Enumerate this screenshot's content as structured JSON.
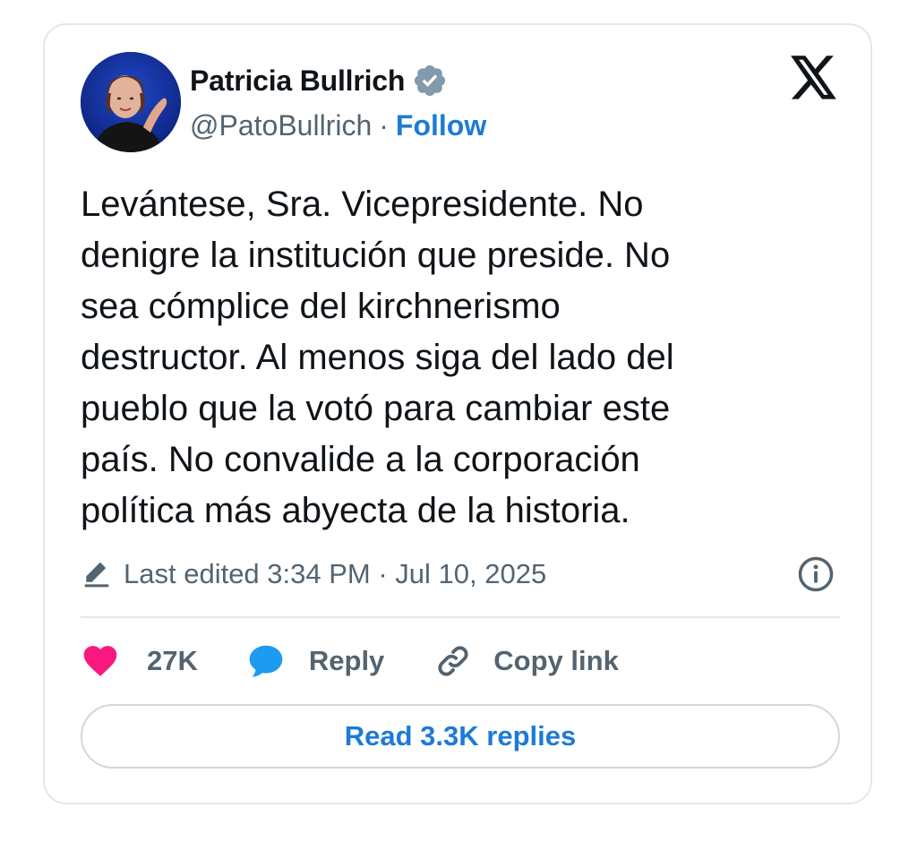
{
  "author": {
    "display_name": "Patricia Bullrich",
    "handle": "@PatoBullrich",
    "separator": "·",
    "follow_label": "Follow",
    "verified": true
  },
  "tweet": {
    "text": "Levántese, Sra. Vicepresidente. No\ndenigre la institución que preside. No\nsea cómplice del kirchnerismo\ndestructor. Al menos siga del lado del\npueblo que la votó para cambiar este\npaís. No convalide a la corporación\npolítica más abyecta de la historia.",
    "edited_label": "Last edited 3:34 PM · Jul 10, 2025"
  },
  "actions": {
    "like_count": "27K",
    "reply_label": "Reply",
    "copy_link_label": "Copy link",
    "read_replies_label": "Read 3.3K replies"
  },
  "icons": {
    "brand": "x-logo-icon",
    "verified": "verified-badge-icon",
    "edited": "pencil-icon",
    "info": "info-icon",
    "like": "heart-icon",
    "reply": "speech-bubble-icon",
    "copy_link": "link-icon"
  },
  "colors": {
    "text": "#0f1419",
    "secondary": "#536471",
    "accent": "#1d7bd6",
    "like": "#f91880",
    "reply": "#1d9bf0",
    "border": "#e1e8ed"
  }
}
